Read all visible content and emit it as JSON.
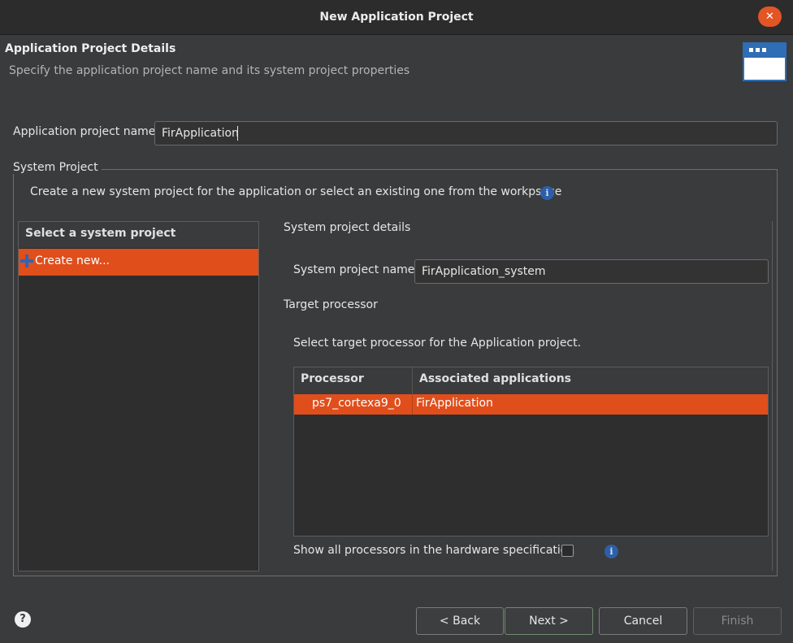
{
  "window": {
    "title": "New Application Project",
    "close_glyph": "✕"
  },
  "header": {
    "title": "Application Project Details",
    "subtitle": "Specify the application project name and its system project properties",
    "icon": "wizard-window-icon"
  },
  "app_name": {
    "label": "Application project name:",
    "value": "FirApplication"
  },
  "system_project": {
    "legend": "System Project",
    "description": "Create a new system project for the application or select an existing one from the workpsace",
    "info_glyph": "i",
    "list": {
      "header": "Select a system project",
      "items": [
        {
          "label": "Create new...",
          "icon": "plus-icon",
          "selected": true
        }
      ]
    },
    "details": {
      "heading": "System project details",
      "name_label": "System project name:",
      "name_value": "FirApplication_system",
      "target_heading": "Target processor",
      "target_desc": "Select target processor for the Application project.",
      "table": {
        "columns": [
          "Processor",
          "Associated applications"
        ],
        "rows": [
          {
            "processor": "ps7_cortexa9_0",
            "applications": "FirApplication",
            "selected": true
          }
        ]
      },
      "show_all_label": "Show all processors in the hardware specification",
      "show_all_checked": false
    }
  },
  "footer": {
    "help_glyph": "?",
    "back": "< Back",
    "next": "Next >",
    "cancel": "Cancel",
    "finish": "Finish",
    "finish_enabled": false
  },
  "colors": {
    "accent": "#e04e1b",
    "info_blue": "#2d5fa8",
    "background": "#3a3b3d"
  }
}
